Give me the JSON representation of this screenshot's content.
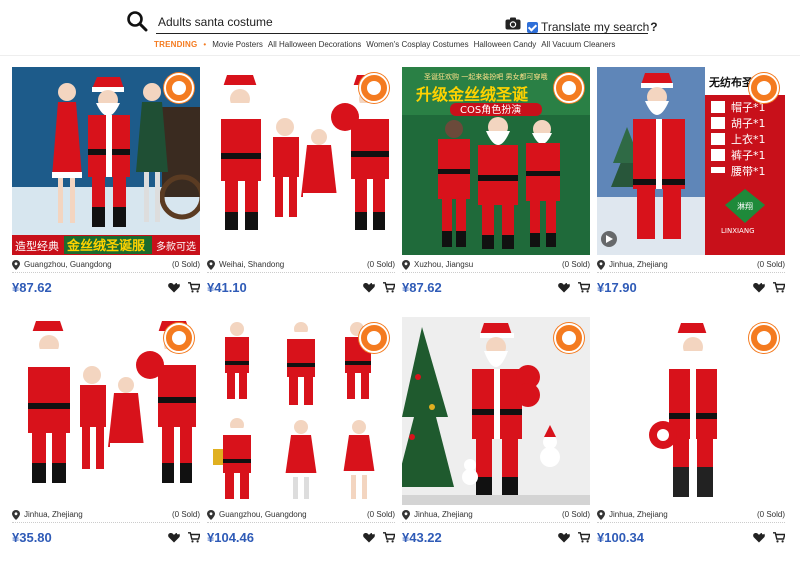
{
  "search": {
    "query": "Adults santa costume",
    "icon": "search-icon",
    "camera_icon": "camera-icon"
  },
  "translate": {
    "label": "Translate my search",
    "help": "?",
    "checked": true
  },
  "trending": {
    "label": "TRENDING",
    "items": [
      "Movie Posters",
      "All Halloween Decorations",
      "Women's Cosplay Costumes",
      "Halloween Candy",
      "All Vacuum Cleaners"
    ]
  },
  "products": [
    {
      "location": "Guangzhou, Guangdong",
      "sold": "(0 Sold)",
      "price": "¥87.62"
    },
    {
      "location": "Weihai, Shandong",
      "sold": "(0 Sold)",
      "price": "¥41.10"
    },
    {
      "location": "Xuzhou, Jiangsu",
      "sold": "(0 Sold)",
      "price": "¥87.62"
    },
    {
      "location": "Jinhua, Zhejiang",
      "sold": "(0 Sold)",
      "price": "¥17.90"
    },
    {
      "location": "Jinhua, Zhejiang",
      "sold": "(0 Sold)",
      "price": "¥35.80"
    },
    {
      "location": "Guangzhou, Guangdong",
      "sold": "(0 Sold)",
      "price": "¥104.46"
    },
    {
      "location": "Jinhua, Zhejiang",
      "sold": "(0 Sold)",
      "price": "¥43.22"
    },
    {
      "location": "Jinhua, Zhejiang",
      "sold": "(0 Sold)",
      "price": "¥100.34"
    }
  ],
  "image_text": {
    "p1": {
      "banner_left": "造型经典",
      "banner_mid": "金丝绒圣诞服",
      "banner_right": "多款可选"
    },
    "p3": {
      "top": "圣诞狂欢购 一起来装扮吧 男女都可穿哦",
      "main": "升级金丝绒圣诞",
      "sub": "COS角色扮演"
    },
    "p4": {
      "header": "无纺布圣诞套",
      "items": [
        "帽子*1",
        "胡子*1",
        "上衣*1",
        "裤子*1",
        "腰带*1"
      ],
      "logo": "淋翔",
      "logo_en": "LINXIANG"
    }
  },
  "colors": {
    "accent_orange": "#f47b20",
    "price_blue": "#2f5bb7",
    "santa_red": "#d8121b",
    "checkbox_blue": "#2f6fd8"
  }
}
